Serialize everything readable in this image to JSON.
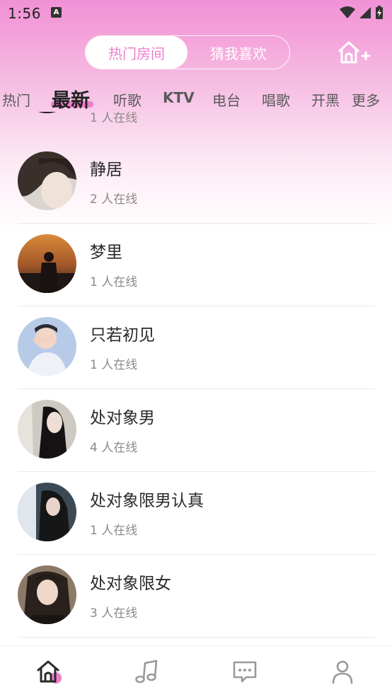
{
  "status_bar": {
    "time": "1:56",
    "notif_letter": "A"
  },
  "segmented": {
    "hot_rooms": "热门房间",
    "guess_like": "猜我喜欢"
  },
  "tabs": [
    {
      "label": "热门"
    },
    {
      "label": "最新"
    },
    {
      "label": "听歌"
    },
    {
      "label": "KTV"
    },
    {
      "label": "电台"
    },
    {
      "label": "唱歌"
    },
    {
      "label": "开黑"
    },
    {
      "label": "更多"
    }
  ],
  "partial_row": {
    "online": "1 人在线"
  },
  "rooms": [
    {
      "name": "静居",
      "online": "2 人在线"
    },
    {
      "name": "梦里",
      "online": "1 人在线"
    },
    {
      "name": "只若初见",
      "online": "1 人在线"
    },
    {
      "name": "处对象男",
      "online": "4 人在线"
    },
    {
      "name": "处对象限男认真",
      "online": "1 人在线"
    },
    {
      "name": "处对象限女",
      "online": "3 人在线"
    }
  ],
  "icons": {
    "create_room": "home-plus-icon",
    "nav": [
      "home-icon",
      "music-note-icon",
      "chat-icon",
      "profile-icon"
    ]
  },
  "colors": {
    "accent": "#ee7fcc",
    "header_top": "#f191d6"
  }
}
